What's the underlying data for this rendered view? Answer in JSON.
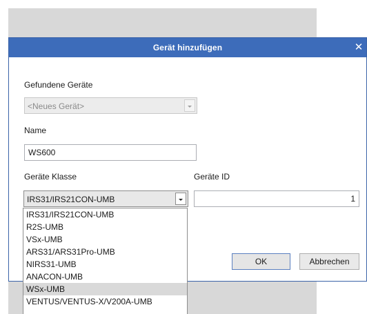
{
  "dialog": {
    "title": "Gerät hinzufügen",
    "close_glyph": "✕"
  },
  "found_devices": {
    "label": "Gefundene Geräte",
    "value": "<Neues Gerät>",
    "enabled": false
  },
  "name": {
    "label": "Name",
    "value": "WS600"
  },
  "device_class": {
    "label": "Geräte Klasse",
    "value": "IRS31/IRS21CON-UMB",
    "options": [
      "IRS31/IRS21CON-UMB",
      "R2S-UMB",
      "VSx-UMB",
      "ARS31/ARS31Pro-UMB",
      "NIRS31-UMB",
      "ANACON-UMB",
      "WSx-UMB",
      "VENTUS/VENTUS-X/V200A-UMB"
    ],
    "highlighted": "WSx-UMB"
  },
  "device_id": {
    "label": "Geräte ID",
    "value": "1"
  },
  "buttons": {
    "ok": "OK",
    "cancel": "Abbrechen"
  },
  "colors": {
    "titlebar": "#3d6cba",
    "dialog_border": "#3a63a8",
    "background_window": "#d8d8d8",
    "highlight": "#d9d9d9"
  }
}
